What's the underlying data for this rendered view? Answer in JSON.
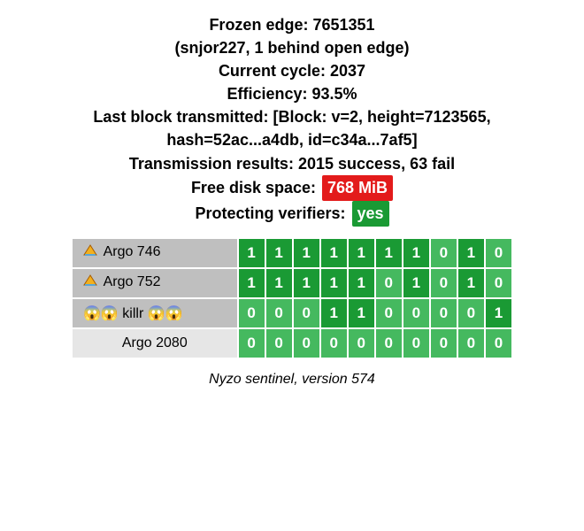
{
  "header": {
    "frozen_edge_label": "Frozen edge:",
    "frozen_edge_value": "7651351",
    "frozen_edge_sub": "(snjor227, 1 behind open edge)",
    "cycle_label": "Current cycle:",
    "cycle_value": "2037",
    "efficiency_label": "Efficiency:",
    "efficiency_value": "93.5%",
    "last_block_line1": "Last block transmitted: [Block: v=2, height=7123565,",
    "last_block_line2": "hash=52ac...a4db, id=c34a...7af5]",
    "tx_results_label": "Transmission results:",
    "tx_results_value": "2015 success, 63 fail",
    "disk_label": "Free disk space:",
    "disk_value": "768 MiB",
    "protecting_label": "Protecting verifiers:",
    "protecting_value": "yes"
  },
  "verifiers": [
    {
      "name": "Argo 746",
      "icon": "triangle",
      "name_style": "gray",
      "bits": [
        1,
        1,
        1,
        1,
        1,
        1,
        1,
        0,
        1,
        0
      ]
    },
    {
      "name": "Argo 752",
      "icon": "triangle",
      "name_style": "gray",
      "bits": [
        1,
        1,
        1,
        1,
        1,
        0,
        1,
        0,
        1,
        0
      ]
    },
    {
      "name": "killr",
      "icon": "scream",
      "name_style": "gray",
      "bits": [
        0,
        0,
        0,
        1,
        1,
        0,
        0,
        0,
        0,
        1
      ]
    },
    {
      "name": "Argo 2080",
      "icon": "none",
      "name_style": "light",
      "bits": [
        0,
        0,
        0,
        0,
        0,
        0,
        0,
        0,
        0,
        0
      ]
    }
  ],
  "footer": {
    "text": "Nyzo sentinel, version 574"
  },
  "chart_data": {
    "type": "heatmap",
    "title": "Verifier bit results",
    "categories": [
      "Argo 746",
      "Argo 752",
      "killr",
      "Argo 2080"
    ],
    "series": [
      {
        "name": "Argo 746",
        "values": [
          1,
          1,
          1,
          1,
          1,
          1,
          1,
          0,
          1,
          0
        ]
      },
      {
        "name": "Argo 752",
        "values": [
          1,
          1,
          1,
          1,
          1,
          0,
          1,
          0,
          1,
          0
        ]
      },
      {
        "name": "killr",
        "values": [
          0,
          0,
          0,
          1,
          1,
          0,
          0,
          0,
          0,
          1
        ]
      },
      {
        "name": "Argo 2080",
        "values": [
          0,
          0,
          0,
          0,
          0,
          0,
          0,
          0,
          0,
          0
        ]
      }
    ]
  }
}
